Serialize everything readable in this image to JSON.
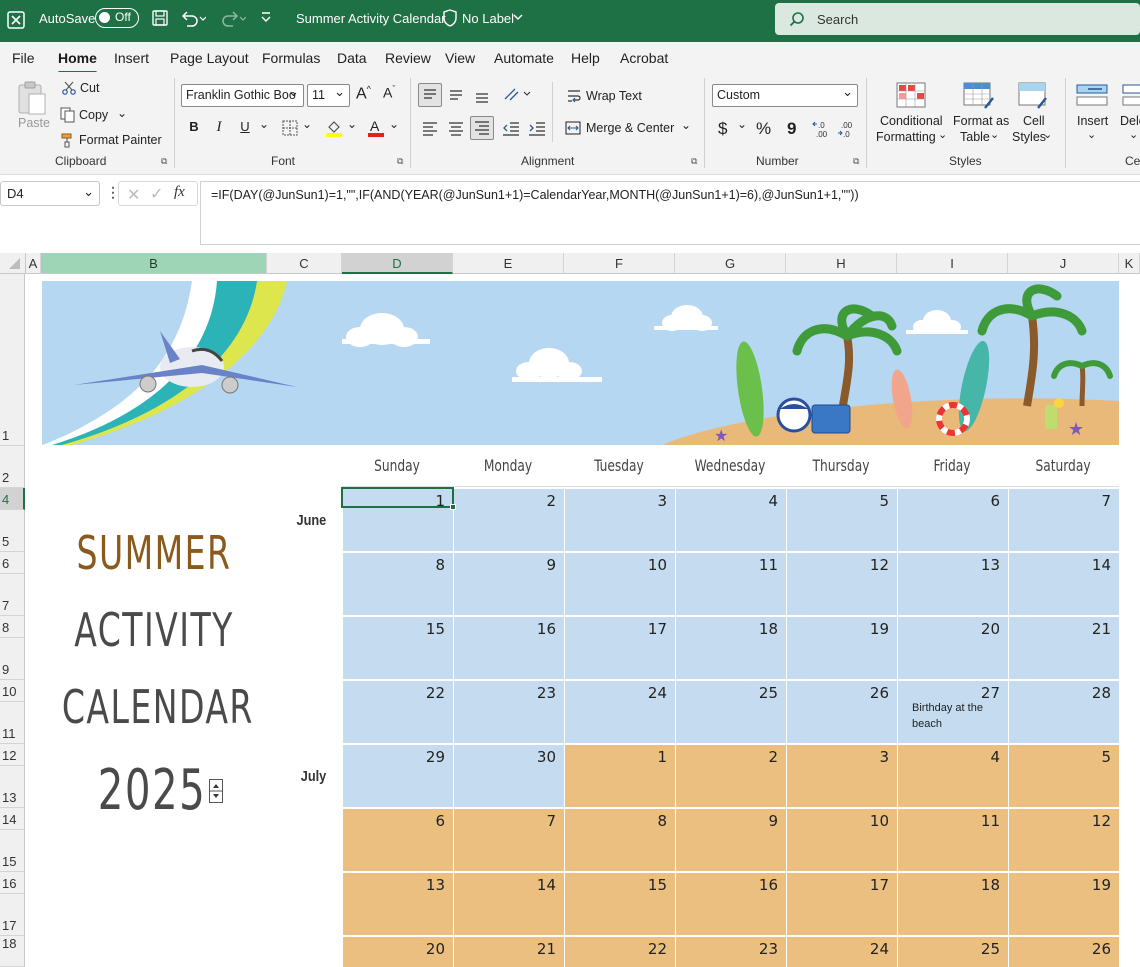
{
  "titlebar": {
    "autosave_label": "AutoSave",
    "autosave_state": "Off",
    "doc_title": "Summer Activity Calendar",
    "sensitivity": "No Label",
    "search_placeholder": "Search"
  },
  "menu": [
    "File",
    "Home",
    "Insert",
    "Page Layout",
    "Formulas",
    "Data",
    "Review",
    "View",
    "Automate",
    "Help",
    "Acrobat"
  ],
  "ribbon": {
    "clipboard": {
      "paste": "Paste",
      "cut": "Cut",
      "copy": "Copy",
      "format_painter": "Format Painter",
      "label": "Clipboard"
    },
    "font": {
      "name": "Franklin Gothic Boo",
      "size": "11",
      "bold": "B",
      "italic": "I",
      "underline": "U",
      "label": "Font"
    },
    "alignment": {
      "wrap": "Wrap Text",
      "merge": "Merge & Center",
      "label": "Alignment"
    },
    "number": {
      "format": "Custom",
      "currency": "$",
      "percent": "%",
      "comma": "9",
      "label": "Number"
    },
    "styles": {
      "conditional": "Conditional",
      "conditional2": "Formatting",
      "format_table": "Format as",
      "format_table2": "Table",
      "cell_styles": "Cell",
      "cell_styles2": "Styles",
      "label": "Styles"
    },
    "cells": {
      "insert": "Insert",
      "delete": "Dele",
      "label": "Cel"
    }
  },
  "formula_bar": {
    "name_box": "D4",
    "fx": "fx",
    "formula": "=IF(DAY(@JunSun1)=1,\"\",IF(AND(YEAR(@JunSun1+1)=CalendarYear,MONTH(@JunSun1+1)=6),@JunSun1+1,\"\"))"
  },
  "columns": [
    "A",
    "B",
    "C",
    "D",
    "E",
    "F",
    "G",
    "H",
    "I",
    "J",
    "K"
  ],
  "rows": [
    "1",
    "2",
    "4",
    "5",
    "6",
    "7",
    "8",
    "9",
    "10",
    "11",
    "12",
    "13",
    "14",
    "15",
    "16",
    "17",
    "18"
  ],
  "calendar": {
    "title_lines": [
      "SUMMER",
      "ACTIVITY",
      "CALENDAR"
    ],
    "year": "2025",
    "days": [
      "Sunday",
      "Monday",
      "Tuesday",
      "Wednesday",
      "Thursday",
      "Friday",
      "Saturday"
    ],
    "months": [
      "June",
      "July"
    ],
    "weeks": [
      [
        "1",
        "2",
        "3",
        "4",
        "5",
        "6",
        "7"
      ],
      [
        "8",
        "9",
        "10",
        "11",
        "12",
        "13",
        "14"
      ],
      [
        "15",
        "16",
        "17",
        "18",
        "19",
        "20",
        "21"
      ],
      [
        "22",
        "23",
        "24",
        "25",
        "26",
        "27",
        "28"
      ],
      [
        "29",
        "30",
        "1",
        "2",
        "3",
        "4",
        "5"
      ],
      [
        "6",
        "7",
        "8",
        "9",
        "10",
        "11",
        "12"
      ],
      [
        "13",
        "14",
        "15",
        "16",
        "17",
        "18",
        "19"
      ],
      [
        "20",
        "21",
        "22",
        "23",
        "24",
        "25",
        "26"
      ]
    ],
    "note": "Birthday at the beach",
    "colors": {
      "june": "#c5dcf0",
      "july": "#ebbf80",
      "title_summer": "#8a5a1c",
      "title_other": "#4a4a4a",
      "excel_green": "#1e7145"
    }
  }
}
